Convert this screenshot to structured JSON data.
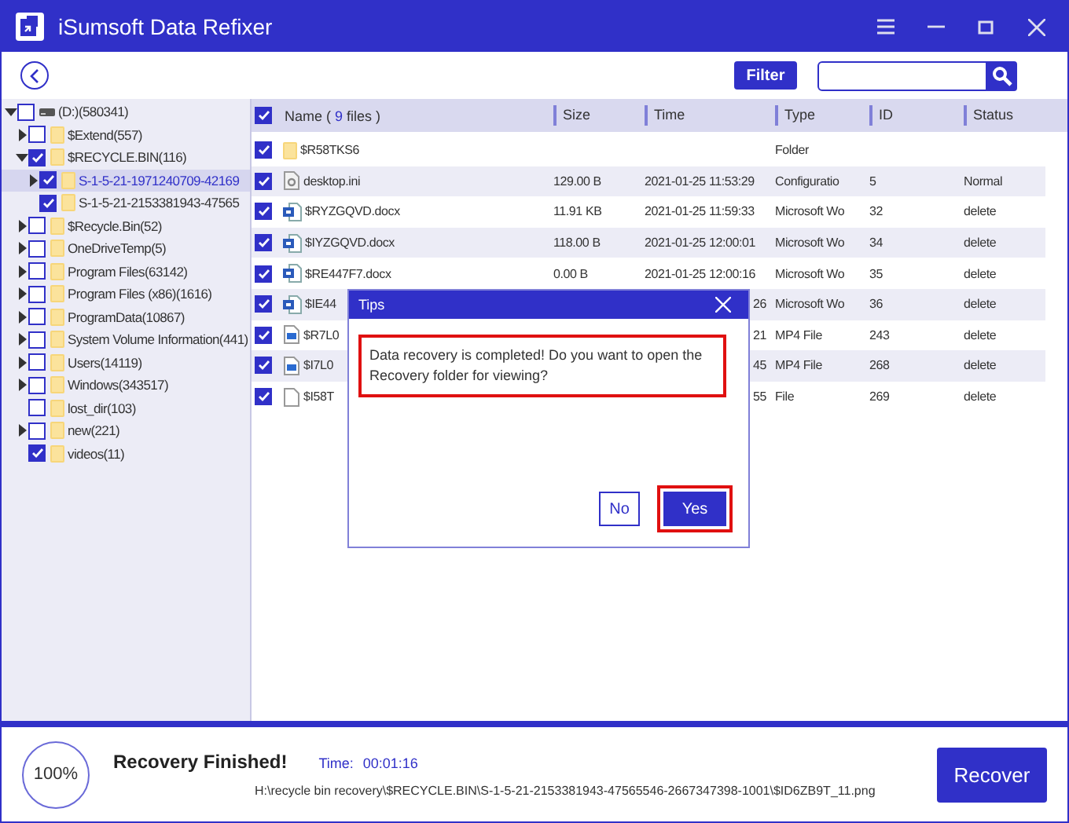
{
  "window": {
    "title": "iSumsoft Data Refixer"
  },
  "toolbar": {
    "filter_button": "Filter"
  },
  "tree": [
    {
      "label": "(D:)(580341)",
      "kind": "drive",
      "checked": false,
      "expandable": true,
      "expanded": true,
      "selected": false,
      "children": [
        {
          "label": "$Extend(557)",
          "kind": "folder",
          "checked": false,
          "expandable": true,
          "expanded": false,
          "selected": false
        },
        {
          "label": "$RECYCLE.BIN(116)",
          "kind": "folder",
          "checked": true,
          "expandable": true,
          "expanded": true,
          "selected": false,
          "children": [
            {
              "label": "S-1-5-21-1971240709-42169",
              "kind": "folder",
              "checked": true,
              "expandable": true,
              "expanded": false,
              "selected": true
            },
            {
              "label": "S-1-5-21-2153381943-47565",
              "kind": "folder",
              "checked": true,
              "expandable": false,
              "selected": false
            }
          ]
        },
        {
          "label": "$Recycle.Bin(52)",
          "kind": "folder",
          "checked": false,
          "expandable": true,
          "expanded": false,
          "selected": false
        },
        {
          "label": "OneDriveTemp(5)",
          "kind": "folder",
          "checked": false,
          "expandable": true,
          "expanded": false,
          "selected": false
        },
        {
          "label": "Program Files(63142)",
          "kind": "folder",
          "checked": false,
          "expandable": true,
          "expanded": false,
          "selected": false
        },
        {
          "label": "Program Files (x86)(1616)",
          "kind": "folder",
          "checked": false,
          "expandable": true,
          "expanded": false,
          "selected": false
        },
        {
          "label": "ProgramData(10867)",
          "kind": "folder",
          "checked": false,
          "expandable": true,
          "expanded": false,
          "selected": false
        },
        {
          "label": "System Volume Information(441)",
          "kind": "folder",
          "checked": false,
          "expandable": true,
          "expanded": false,
          "selected": false
        },
        {
          "label": "Users(14119)",
          "kind": "folder",
          "checked": false,
          "expandable": true,
          "expanded": false,
          "selected": false
        },
        {
          "label": "Windows(343517)",
          "kind": "folder",
          "checked": false,
          "expandable": true,
          "expanded": false,
          "selected": false
        },
        {
          "label": "lost_dir(103)",
          "kind": "folder",
          "checked": false,
          "expandable": false,
          "selected": false
        },
        {
          "label": "new(221)",
          "kind": "folder",
          "checked": false,
          "expandable": true,
          "expanded": false,
          "selected": false
        },
        {
          "label": "videos(11)",
          "kind": "folder",
          "checked": true,
          "expandable": false,
          "selected": false
        }
      ]
    }
  ],
  "table": {
    "all_checked": true,
    "name_heading": {
      "before": "Name ( ",
      "count": "9",
      "after": " files )"
    },
    "columns": [
      "Size",
      "Time",
      "Type",
      "ID",
      "Status"
    ],
    "rows": [
      {
        "checked": true,
        "kind": "folder",
        "name": "$R58TKS6",
        "size": "",
        "time": "",
        "type": "Folder",
        "id": "",
        "status": ""
      },
      {
        "checked": true,
        "kind": "config",
        "name": "desktop.ini",
        "size": "129.00 B",
        "time": "2021-01-25 11:53:29",
        "type": "Configuratio",
        "id": "5",
        "status": "Normal"
      },
      {
        "checked": true,
        "kind": "word",
        "name": "$RYZGQVD.docx",
        "size": "11.91 KB",
        "time": "2021-01-25 11:59:33",
        "type": "Microsoft Wo",
        "id": "32",
        "status": "delete"
      },
      {
        "checked": true,
        "kind": "word",
        "name": "$IYZGQVD.docx",
        "size": "118.00 B",
        "time": "2021-01-25 12:00:01",
        "type": "Microsoft Wo",
        "id": "34",
        "status": "delete"
      },
      {
        "checked": true,
        "kind": "word",
        "name": "$RE447F7.docx",
        "size": "0.00 B",
        "time": "2021-01-25 12:00:16",
        "type": "Microsoft Wo",
        "id": "35",
        "status": "delete"
      },
      {
        "checked": true,
        "kind": "word",
        "name": "$IE44",
        "time": "26",
        "type": "Microsoft Wo",
        "id": "36",
        "status": "delete",
        "covered": true
      },
      {
        "checked": true,
        "kind": "video",
        "name": "$R7L0",
        "time": "21",
        "type": "MP4 File",
        "id": "243",
        "status": "delete",
        "covered": true
      },
      {
        "checked": true,
        "kind": "video",
        "name": "$I7L0",
        "time": "45",
        "type": "MP4 File",
        "id": "268",
        "status": "delete",
        "covered": true
      },
      {
        "checked": true,
        "kind": "file",
        "name": "$I58T",
        "time": "55",
        "type": "File",
        "id": "269",
        "status": "delete",
        "covered": true
      }
    ]
  },
  "dialog": {
    "title": "Tips",
    "message": "Data recovery is completed! Do you want to open the Recovery folder for viewing?",
    "buttons": [
      {
        "label": "No",
        "selected": false
      },
      {
        "label": "Yes",
        "selected": true
      }
    ]
  },
  "status": {
    "percent": "100%",
    "headline": "Recovery Finished!",
    "time_label": "Time:",
    "time": "00:01:16",
    "path": "H:\\recycle bin recovery\\$RECYCLE.BIN\\S-1-5-21-2153381943-47565546-2667347398-1001\\$ID6ZB9T_11.png",
    "recover_button": "Recover"
  }
}
